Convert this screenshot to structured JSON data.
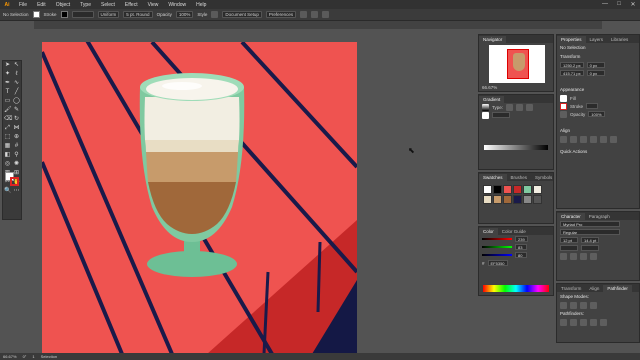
{
  "app": {
    "logo": "Ai",
    "menus": [
      "File",
      "Edit",
      "Object",
      "Type",
      "Select",
      "Effect",
      "View",
      "Window",
      "Help"
    ],
    "window_controls": [
      "—",
      "□",
      "✕"
    ]
  },
  "control_bar": {
    "selection_label": "No Selection",
    "fill_label": "Fill",
    "stroke_label": "Stroke",
    "stroke_weight": "",
    "brush_label": "Uniform",
    "brush_size": "5 pt. Round",
    "opacity_label": "Opacity",
    "opacity_value": "100%",
    "style_label": "Style",
    "doc_setup_label": "Document Setup",
    "preferences_label": "Preferences"
  },
  "document_tab": {
    "title": ""
  },
  "canvas": {
    "colors": {
      "table_top": "#ef5350",
      "table_side": "#c62828",
      "stripe": "#1a1a4a",
      "shadow": "#141845",
      "glass_rim": "#7fc9a0",
      "glass_stem": "#6dbf95",
      "foam": "#f2eee2",
      "cream": "#e8ddc4",
      "latte": "#c79b6b",
      "coffee": "#a0683a"
    }
  },
  "status_bar": {
    "zoom": "66.67%",
    "angle": "0°",
    "page": "1",
    "tool": "Selection"
  },
  "navigator": {
    "tabs": [
      "Navigator"
    ],
    "zoom": "66.67%"
  },
  "properties": {
    "tabs": [
      "Properties",
      "Layers",
      "Libraries"
    ],
    "subtitle": "No Selection",
    "transform_label": "Transform",
    "x_value": "1250.2 px",
    "y_value": "415.71 px",
    "w_value": "0 px",
    "h_value": "0 px",
    "appearance_label": "Appearance",
    "fill_label": "Fill",
    "stroke_label": "Stroke",
    "opacity_label": "Opacity",
    "opacity_value": "100%",
    "align_label": "Align",
    "quick_actions_label": "Quick Actions"
  },
  "gradient": {
    "tabs": [
      "Gradient"
    ],
    "type_label": "Type:"
  },
  "swatches": {
    "tabs": [
      "Swatches",
      "Brushes",
      "Symbols"
    ],
    "colors": [
      "#ffffff",
      "#000000",
      "#ef5350",
      "#c62828",
      "#7fc9a0",
      "#f2eee2",
      "#e8ddc4",
      "#c79b6b",
      "#a0683a",
      "#1a1a4a",
      "#888888",
      "#555555"
    ]
  },
  "color_panel": {
    "tabs": [
      "Color",
      "Color Guide"
    ],
    "values": [
      "239",
      "83",
      "80"
    ],
    "hex": "EF5350"
  },
  "character": {
    "tabs": [
      "Character",
      "Paragraph"
    ],
    "font": "Myriad Pro",
    "style": "Regular",
    "size": "12 pt",
    "leading": "14.4 pt"
  },
  "transform_tabs": {
    "tabs": [
      "Transform",
      "Align",
      "Pathfinder"
    ],
    "shape_modes": "Shape Modes:",
    "pathfinders": "Pathfinders:"
  }
}
